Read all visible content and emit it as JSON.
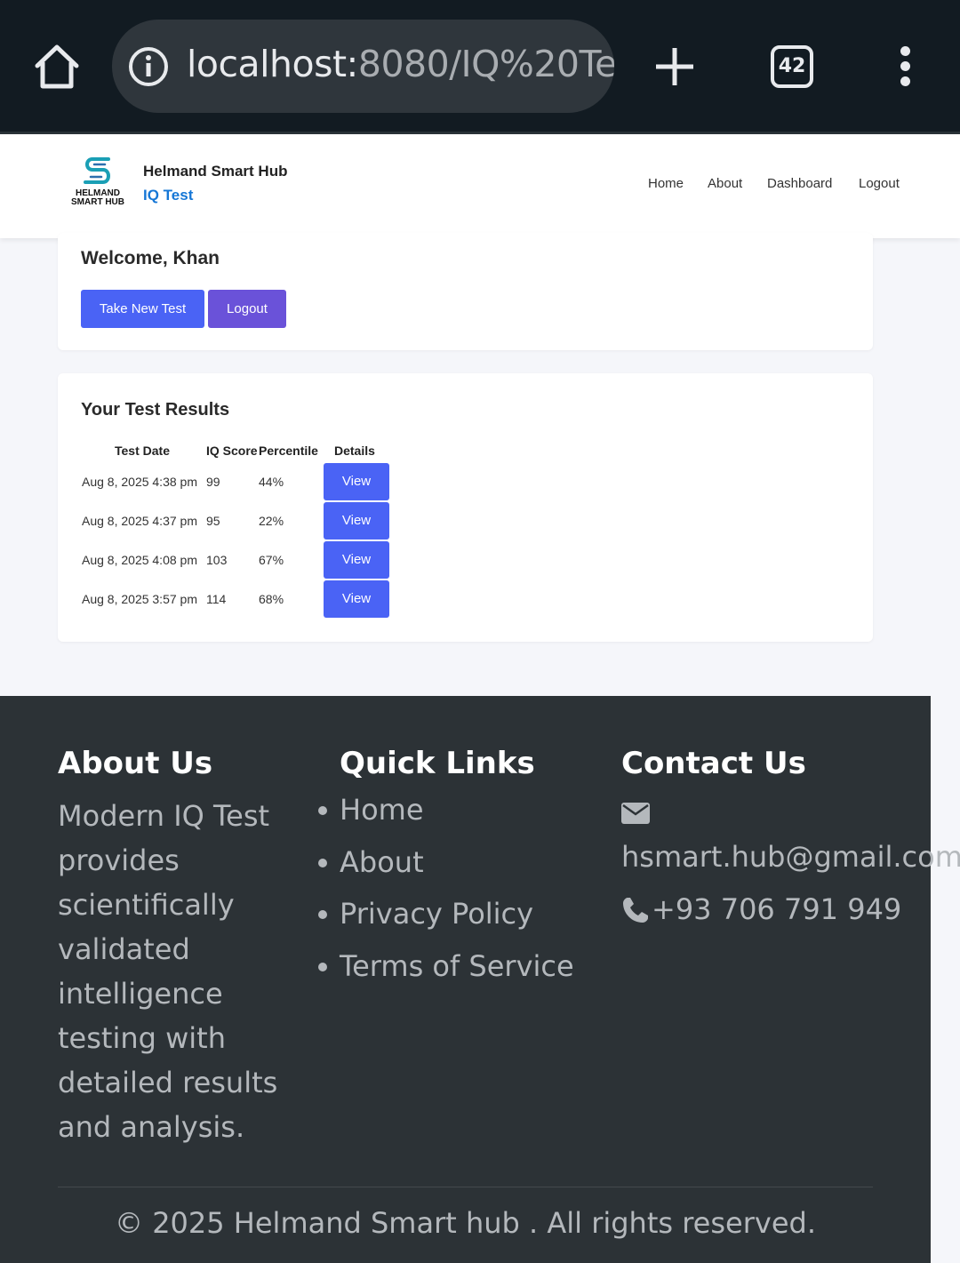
{
  "browser": {
    "url_host": "localhost:",
    "url_rest": "8080/IQ%20Te",
    "tab_count": "42",
    "icons": [
      "home-icon",
      "info-icon",
      "plus-icon",
      "tabs-icon",
      "more-icon"
    ]
  },
  "header": {
    "logo_text_line1": "HELMAND",
    "logo_text_line2": "SMART HUB",
    "brand_name": "Helmand Smart Hub",
    "brand_sub": "IQ Test",
    "nav": [
      "Home",
      "About",
      "Dashboard",
      "Logout"
    ]
  },
  "welcome": {
    "title": "Welcome, Khan",
    "take_new_test": "Take New Test",
    "logout": "Logout"
  },
  "results": {
    "title": "Your Test Results",
    "columns": [
      "Test Date",
      "IQ Score",
      "Percentile",
      "Details"
    ],
    "rows": [
      {
        "date": "Aug 8, 2025 4:38 pm",
        "score": "99",
        "percentile": "44%",
        "action": "View"
      },
      {
        "date": "Aug 8, 2025 4:37 pm",
        "score": "95",
        "percentile": "22%",
        "action": "View"
      },
      {
        "date": "Aug 8, 2025 4:08 pm",
        "score": "103",
        "percentile": "67%",
        "action": "View"
      },
      {
        "date": "Aug 8, 2025 3:57 pm",
        "score": "114",
        "percentile": "68%",
        "action": "View"
      }
    ]
  },
  "footer": {
    "about_title": "About Us",
    "about_text": "Modern IQ Test provides scientifically validated intelligence testing with detailed results and analysis.",
    "links_title": "Quick Links",
    "links": [
      "Home",
      "About",
      "Privacy Policy",
      "Terms of Service"
    ],
    "contact_title": "Contact Us",
    "email": "hsmart.hub@gmail.com",
    "phone": "+93 706 791 949",
    "copyright": "© 2025 Helmand Smart hub . All rights reserved."
  },
  "colors": {
    "primary_button": "#4a63f5",
    "logout_button": "#6a52d9",
    "brand_accent": "#1677d6",
    "footer_bg": "#2c3236",
    "chrome_bg": "#121b22"
  }
}
